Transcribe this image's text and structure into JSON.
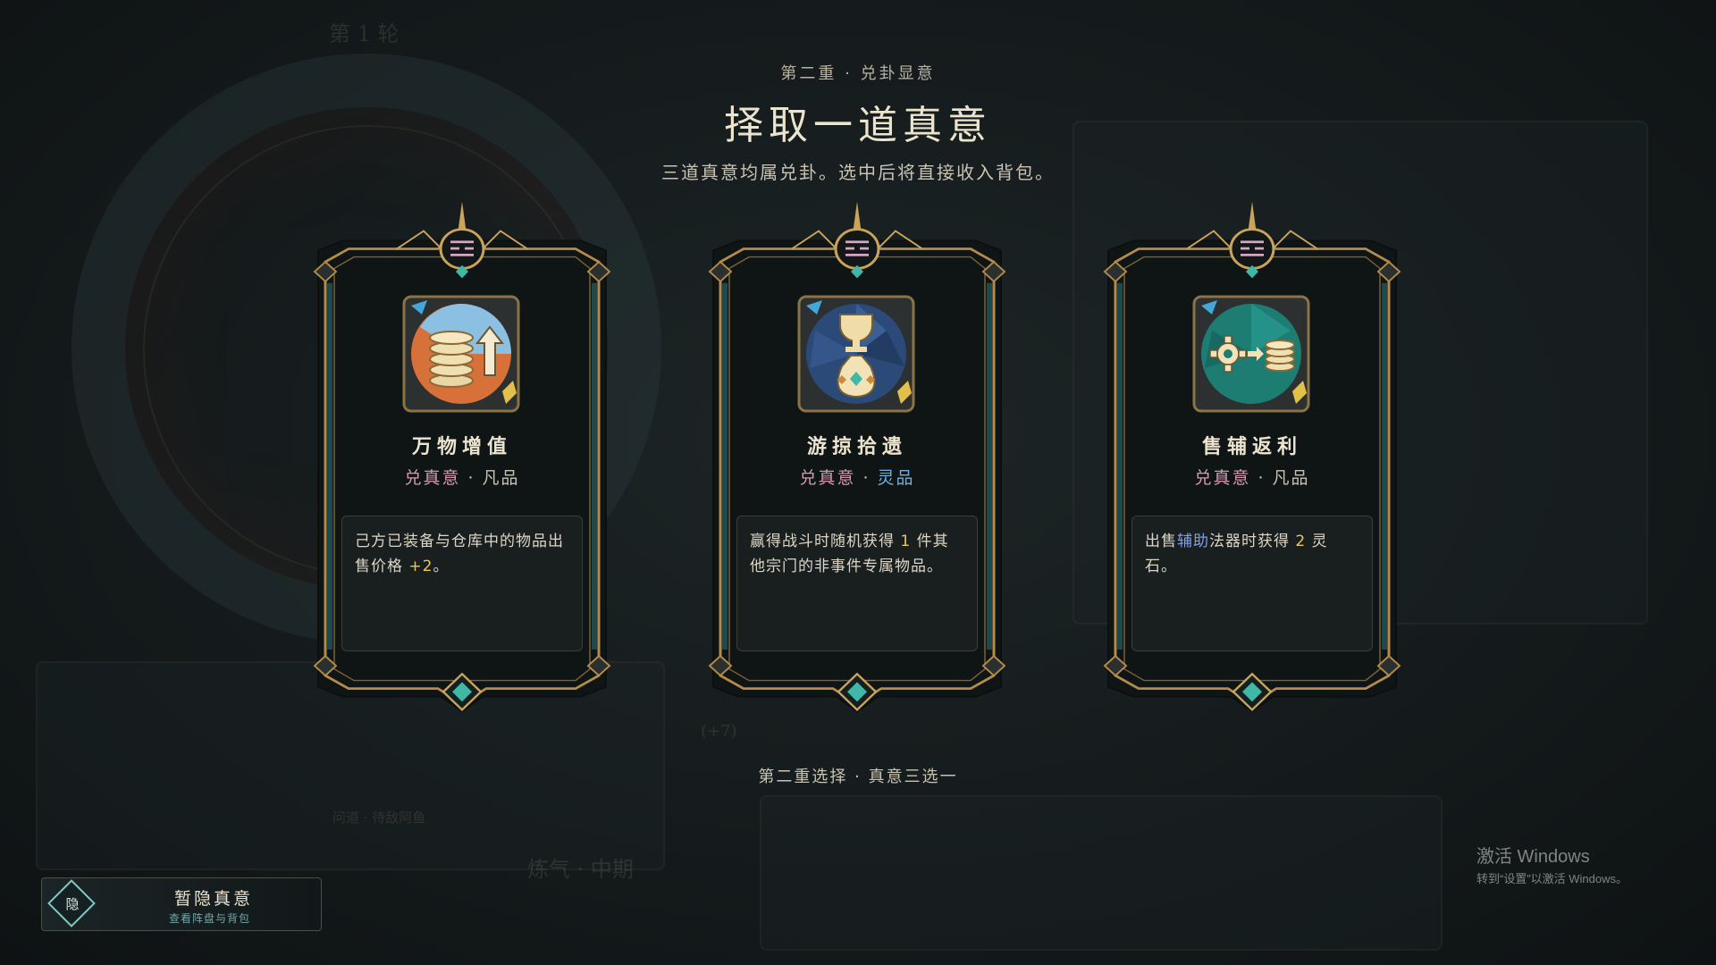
{
  "background": {
    "round_label": "第 1 轮",
    "realm_label": "炼气 · 中期",
    "status_label": "问道 · 待敌阿鱼",
    "plus_label": "(+7)"
  },
  "header": {
    "stage": "第二重 · 兑卦显意",
    "title": "择取一道真意",
    "description": "三道真意均属兑卦。选中后将直接收入背包。"
  },
  "cards": [
    {
      "name": "万物增值",
      "type": "兑真意",
      "rarity": "凡品",
      "icon": "coins-arrow-up-icon",
      "desc_parts": [
        "己方已装备与仓库中的物品出售价格 ",
        "+2",
        "。"
      ]
    },
    {
      "name": "游掠拾遗",
      "type": "兑真意",
      "rarity": "灵品",
      "icon": "trophy-loot-bag-icon",
      "desc_parts": [
        "赢得战斗时随机获得 ",
        "1",
        " 件其他宗门的非事件专属物品。"
      ]
    },
    {
      "name": "售辅返利",
      "type": "兑真意",
      "rarity": "凡品",
      "icon": "gear-to-coins-icon",
      "desc_parts": [
        "出售",
        "辅助",
        "法器时获得 ",
        "2",
        " 灵石。"
      ]
    }
  ],
  "footer": {
    "note": "第二重选择 · 真意三选一"
  },
  "hide_button": {
    "glyph": "隐",
    "label": "暂隐真意",
    "sublabel": "查看阵盘与背包"
  },
  "watermark": {
    "title": "激活 Windows",
    "subtitle": "转到“设置”以激活 Windows。"
  },
  "colors": {
    "accent_gold": "#c9a45a",
    "teal": "#3fb8a8",
    "type_pink": "#d49ab4",
    "spirit_blue": "#6fb0e0",
    "number_yellow": "#e8c85a",
    "link_blue": "#7f9ff0"
  }
}
